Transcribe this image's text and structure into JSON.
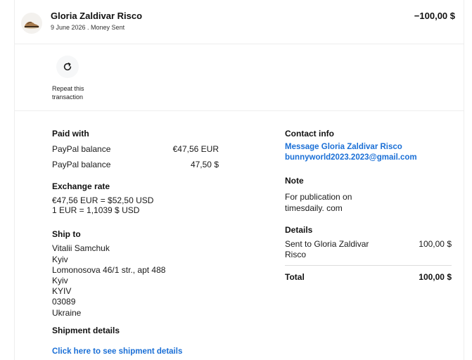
{
  "header": {
    "name": "Gloria Zaldivar Risco",
    "subtitle": "9 June 2026 . Money Sent",
    "amount": "−100,00 $",
    "avatar_icon": "shoes-product-thumbnail"
  },
  "repeat": {
    "icon": "refresh-icon",
    "label": "Repeat this transaction"
  },
  "paid_with": {
    "title": "Paid with",
    "rows": [
      {
        "label": "PayPal balance",
        "value": "€47,56 EUR"
      },
      {
        "label": "PayPal balance",
        "value": "47,50 $"
      }
    ]
  },
  "exchange": {
    "title": "Exchange rate",
    "line1": "€47,56 EUR = $52,50 USD",
    "line2": "1 EUR = 1,1039 $ USD"
  },
  "ship_to": {
    "title": "Ship to",
    "lines": [
      "Vitalii Samchuk",
      "Kyiv",
      "Lomonosova 46/1 str., apt 488",
      "Kyiv",
      "KYIV",
      "03089",
      "Ukraine"
    ]
  },
  "shipment": {
    "title": "Shipment details",
    "link": "Click here to see shipment details"
  },
  "contact": {
    "title": "Contact info",
    "message_link": "Message Gloria Zaldivar Risco",
    "email_link": "bunnyworld2023.2023@gmail.com"
  },
  "note": {
    "title": "Note",
    "line1": "For publication on",
    "line2": "timesdaily. com"
  },
  "details": {
    "title": "Details",
    "sent_label_1": "Sent to Gloria Zaldivar",
    "sent_label_2": "Risco",
    "sent_value": "100,00 $",
    "total_label": "Total",
    "total_value": "100,00 $"
  }
}
